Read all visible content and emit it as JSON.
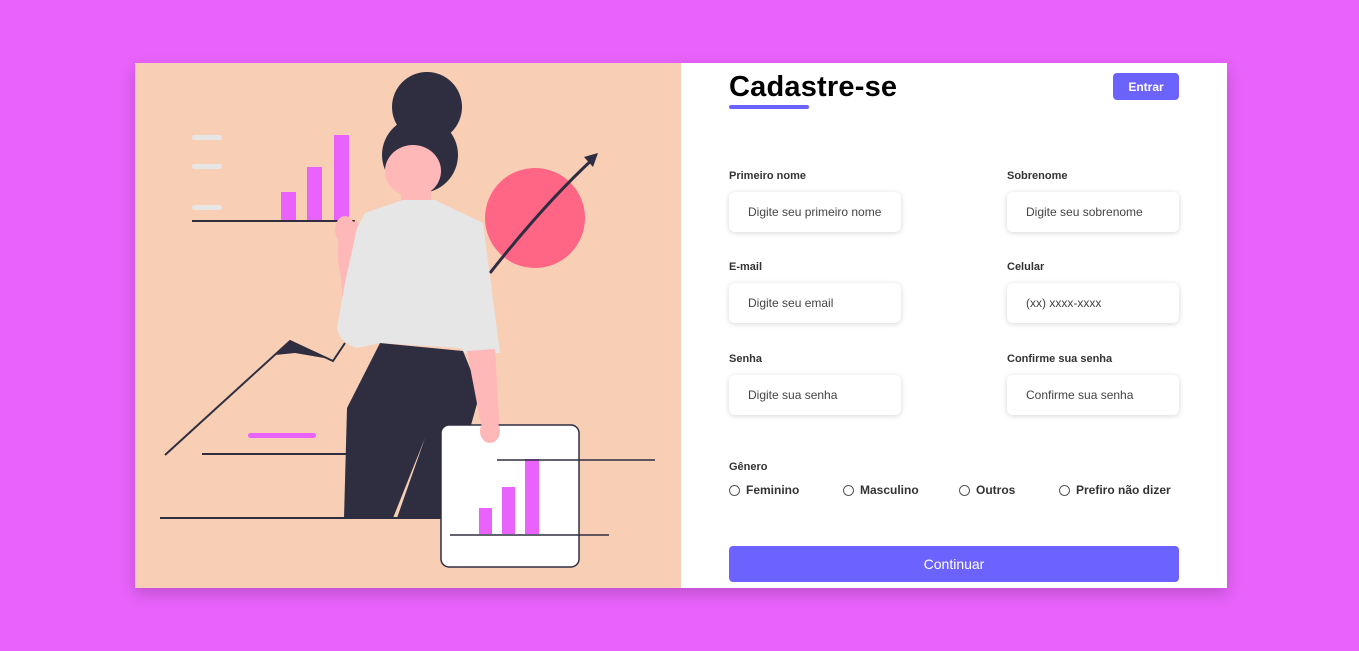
{
  "form": {
    "title": "Cadastre-se",
    "login_label": "Entrar",
    "fields": {
      "first_name": {
        "label": "Primeiro nome",
        "placeholder": "Digite seu primeiro nome"
      },
      "last_name": {
        "label": "Sobrenome",
        "placeholder": "Digite seu sobrenome"
      },
      "email": {
        "label": "E-mail",
        "placeholder": "Digite seu email"
      },
      "phone": {
        "label": "Celular",
        "placeholder": "(xx) xxxx-xxxx"
      },
      "password": {
        "label": "Senha",
        "placeholder": "Digite sua senha"
      },
      "confirm_password": {
        "label": "Confirme sua senha",
        "placeholder": "Confirme sua senha"
      }
    },
    "gender": {
      "label": "Gênero",
      "options": [
        "Feminino",
        "Masculino",
        "Outros",
        "Prefiro não dizer"
      ]
    },
    "continue_label": "Continuar"
  },
  "colors": {
    "page_background": "#e862fb",
    "illustration_background": "#f8cfb5",
    "accent": "#6c63ff",
    "chart_bar": "#e862fb",
    "circle": "#ff6584",
    "dark": "#2f2e41"
  }
}
